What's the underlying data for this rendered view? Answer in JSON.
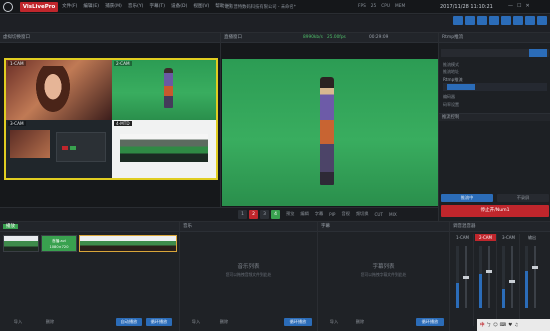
{
  "app": {
    "brand": "VisLivePro",
    "company": "北京普特数码科技有限公司 - 未命名*",
    "menu": [
      "文件(F)",
      "编辑(E)",
      "捕获(M)",
      "音乐(Y)",
      "字幕(T)",
      "设备(D)",
      "视图(V)",
      "帮助(H)"
    ],
    "status": [
      "FPS",
      "25",
      "CPU",
      "MEM"
    ],
    "datetime": "2017/11/28  11:10:21",
    "window_controls": [
      "—",
      "☐",
      "✕"
    ]
  },
  "preview": {
    "title": "虚拟切换窗口",
    "cams": [
      "1-CAM",
      "2-CAM",
      "3-CAM",
      "4-MTD"
    ]
  },
  "live": {
    "title": "直播窗口",
    "bitrate_a": "8990kb/s",
    "bitrate_b": "25.00fps",
    "timer": "00:29:09"
  },
  "props": {
    "title": "Rtmp推流",
    "rows": [
      "推流模式",
      "推流地址",
      "编码器",
      "码率设置"
    ],
    "rtmp_label": "Rtmp推流",
    "btn_left": "推流中",
    "btn_right": "不录屏",
    "section2": "推流控制",
    "start_btn": "停止开/Num1"
  },
  "pgm": {
    "nums": [
      "1",
      "2",
      "3",
      "4"
    ],
    "labels": [
      "预览",
      "编辑",
      "字幕",
      "PIP",
      "音视",
      "频切换",
      "CUT",
      "MIX"
    ]
  },
  "bottom": {
    "scenes_title": "播放",
    "scene_labels": [
      "首播.avi",
      "1080×720"
    ],
    "music_title": "音乐",
    "music_empty": "音乐列表",
    "music_hint": "您可以拖拽音频文件到此处",
    "subtitle_title": "字幕",
    "subtitle_empty": "字幕列表",
    "subtitle_hint": "您可以拖拽字幕文件到此处",
    "mixer_title": "调音混音器",
    "mixer_channels": [
      "1-CAM",
      "2-CAM",
      "3-CAM",
      "输出"
    ],
    "btns": [
      "导入",
      "删除",
      "自动播放",
      "循环播放",
      "导入",
      "删除",
      "循环播放",
      "导入",
      "删除",
      "循环播放"
    ]
  },
  "taskbar": [
    "中",
    "ㄅ",
    "☺",
    "⌨",
    "♥",
    "♫"
  ]
}
